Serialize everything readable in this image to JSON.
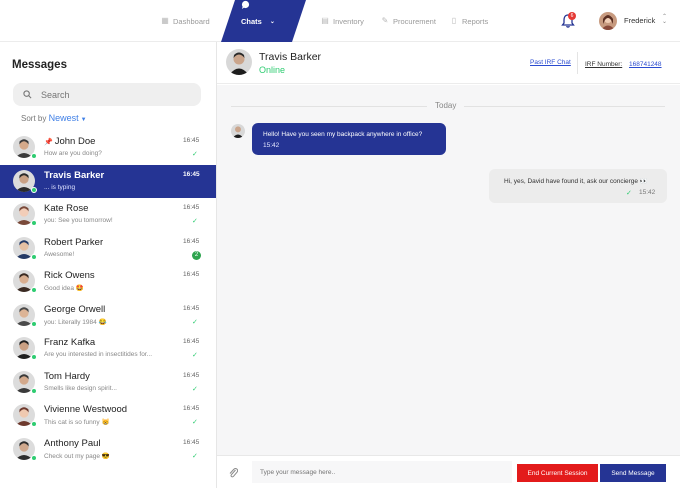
{
  "nav": {
    "items": [
      {
        "label": "Dashboard",
        "icon": "dashboard-icon"
      },
      {
        "label": "Chats",
        "icon": "chat-icon"
      },
      {
        "label": "Inventory",
        "icon": "inventory-icon"
      },
      {
        "label": "Procurement",
        "icon": "procurement-icon"
      },
      {
        "label": "Reports",
        "icon": "reports-icon"
      }
    ],
    "active_index": 1,
    "notifications_count": "6",
    "user_name": "Frederick"
  },
  "sidebar": {
    "title": "Messages",
    "search_placeholder": "Search",
    "sort_label": "Sort by",
    "sort_value": "Newest",
    "chats": [
      {
        "name": "John Doe",
        "pinned": true,
        "preview": "How are you doing?",
        "time": "16:45",
        "status": "read",
        "active": false
      },
      {
        "name": "Travis Barker",
        "pinned": false,
        "preview": "... is typing",
        "time": "16:45",
        "status": "typing",
        "active": true
      },
      {
        "name": "Kate Rose",
        "pinned": false,
        "preview": "you: See you tomorrow!",
        "time": "16:45",
        "status": "read",
        "active": false
      },
      {
        "name": "Robert Parker",
        "pinned": false,
        "preview": "Awesome!",
        "time": "16:45",
        "status": "unread",
        "unread": "2",
        "active": false
      },
      {
        "name": "Rick Owens",
        "pinned": false,
        "preview": "Good idea 🤩",
        "time": "16:45",
        "status": "none",
        "active": false
      },
      {
        "name": "George Orwell",
        "pinned": false,
        "preview": "you: Literally 1984 😂",
        "time": "16:45",
        "status": "read",
        "active": false
      },
      {
        "name": "Franz Kafka",
        "pinned": false,
        "preview": "Are you interested in insectitides for...",
        "time": "16:45",
        "status": "read",
        "active": false
      },
      {
        "name": "Tom Hardy",
        "pinned": false,
        "preview": "Smells like design spirit...",
        "time": "16:45",
        "status": "read",
        "active": false
      },
      {
        "name": "Vivienne Westwood",
        "pinned": false,
        "preview": "This cat is so funny 😸",
        "time": "16:45",
        "status": "read",
        "active": false
      },
      {
        "name": "Anthony Paul",
        "pinned": false,
        "preview": "Check out my page 😎",
        "time": "16:45",
        "status": "read",
        "active": false
      }
    ]
  },
  "header": {
    "name": "Travis Barker",
    "status": "Online",
    "past_chat": "Past IRF Chat",
    "irf_label": "IRF Number:",
    "irf_number": "168741248"
  },
  "conversation": {
    "day": "Today",
    "messages": [
      {
        "direction": "in",
        "text": "Hello! Have you seen my backpack anywhere in office?",
        "time": "15:42"
      },
      {
        "direction": "out",
        "text": "Hi, yes, David have found it, ask our concierge 👀",
        "time": "15:42"
      }
    ]
  },
  "composer": {
    "placeholder": "Type your message here..",
    "end_label": "End Current Session",
    "send_label": "Send Message"
  },
  "colors": {
    "accent": "#253494",
    "online": "#2ecc71",
    "danger": "#e31b1b",
    "link": "#2a4bd0"
  }
}
